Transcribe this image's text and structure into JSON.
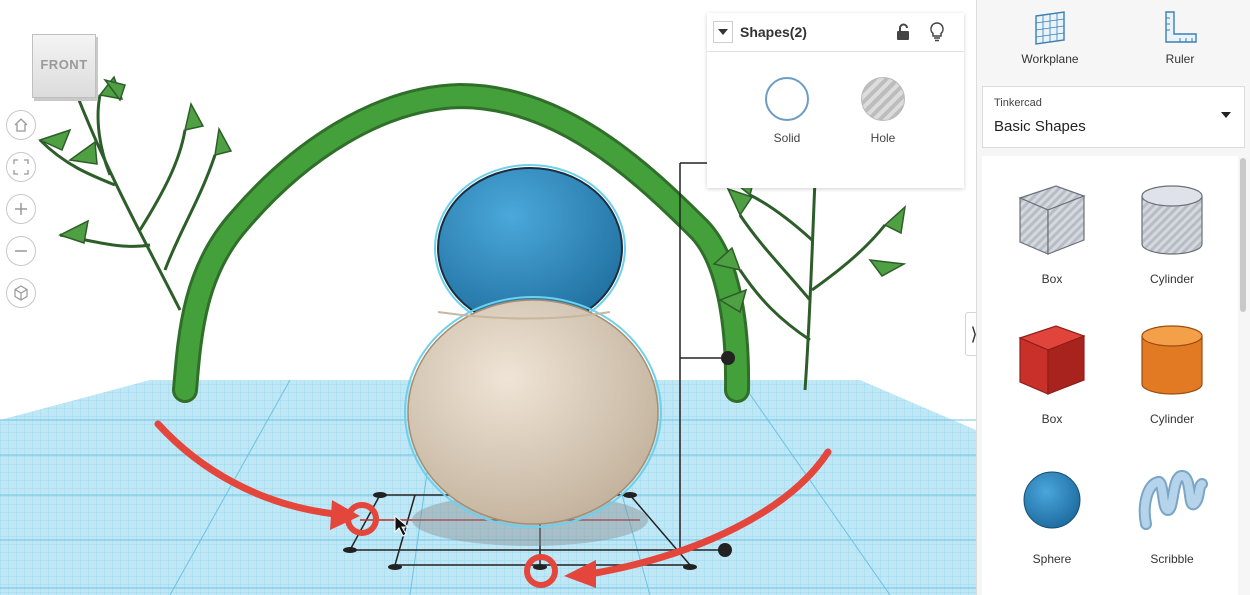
{
  "viewcube": {
    "face_label": "FRONT"
  },
  "nav_controls": [
    "home-view",
    "fit-all",
    "zoom-in",
    "zoom-out",
    "orthographic"
  ],
  "shapes_panel": {
    "title": "Shapes(2)",
    "solid_label": "Solid",
    "hole_label": "Hole"
  },
  "toolbar": {
    "workplane_label": "Workplane",
    "ruler_label": "Ruler"
  },
  "library": {
    "source": "Tinkercad",
    "category": "Basic Shapes"
  },
  "shapes": [
    {
      "label": "Box",
      "icon": "box-hole-icon"
    },
    {
      "label": "Cylinder",
      "icon": "cylinder-hole-icon"
    },
    {
      "label": "Box",
      "icon": "box-red-icon"
    },
    {
      "label": "Cylinder",
      "icon": "cylinder-orange-icon"
    },
    {
      "label": "Sphere",
      "icon": "sphere-blue-icon"
    },
    {
      "label": "Scribble",
      "icon": "scribble-icon"
    }
  ],
  "colors": {
    "accent": "#3b8dd1",
    "grid": "#7fcde8",
    "annotation": "#e4463c",
    "bamboo": "#3f8f32",
    "sphere_top": "#2f88c0",
    "sphere_bottom": "#d9c9b4"
  }
}
